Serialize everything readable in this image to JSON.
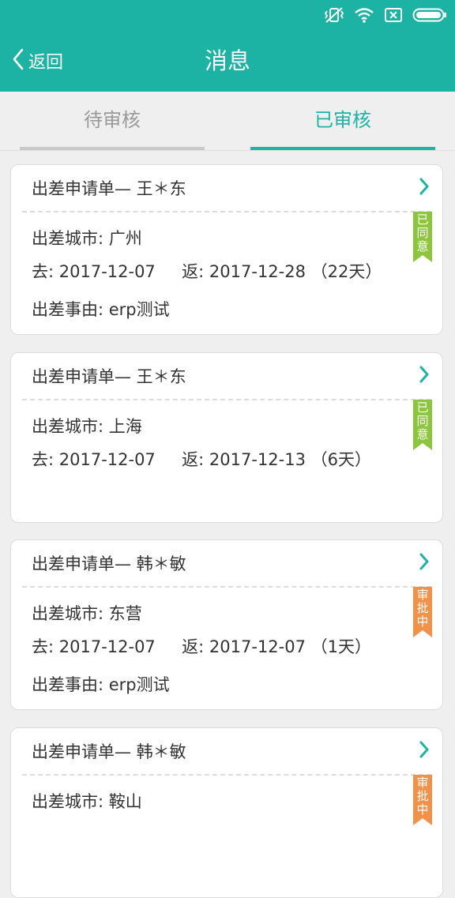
{
  "status_bar": {
    "icons": [
      "vibrate-off-icon",
      "wifi-icon",
      "sim-off-icon",
      "battery-icon"
    ]
  },
  "nav": {
    "back_label": "返回",
    "title": "消息"
  },
  "tabs": [
    {
      "label": "待审核",
      "active": false
    },
    {
      "label": "已审核",
      "active": true
    }
  ],
  "colors": {
    "accent": "#1cb3a5",
    "approved": "#8cc63e",
    "in_review": "#f0924a"
  },
  "cards": [
    {
      "title": "出差申请单— 王＊东",
      "city": "出差城市: 广州",
      "dates": "去: 2017-12-07     返: 2017-12-28 （22天）",
      "reason": "出差事由: erp测试",
      "status": [
        "已",
        "同",
        "意"
      ]
    },
    {
      "title": "出差申请单— 王＊东",
      "city": "出差城市: 上海",
      "dates": "去: 2017-12-07     返: 2017-12-13 （6天）",
      "reason": "",
      "status": [
        "已",
        "同",
        "意"
      ]
    },
    {
      "title": "出差申请单— 韩＊敏",
      "city": "出差城市: 东营",
      "dates": "去: 2017-12-07     返: 2017-12-07 （1天）",
      "reason": "出差事由: erp测试",
      "status": [
        "审",
        "批",
        "中"
      ]
    },
    {
      "title": "出差申请单— 韩＊敏",
      "city": "出差城市: 鞍山",
      "dates": "",
      "reason": "",
      "status": [
        "审",
        "批",
        "中"
      ]
    }
  ]
}
